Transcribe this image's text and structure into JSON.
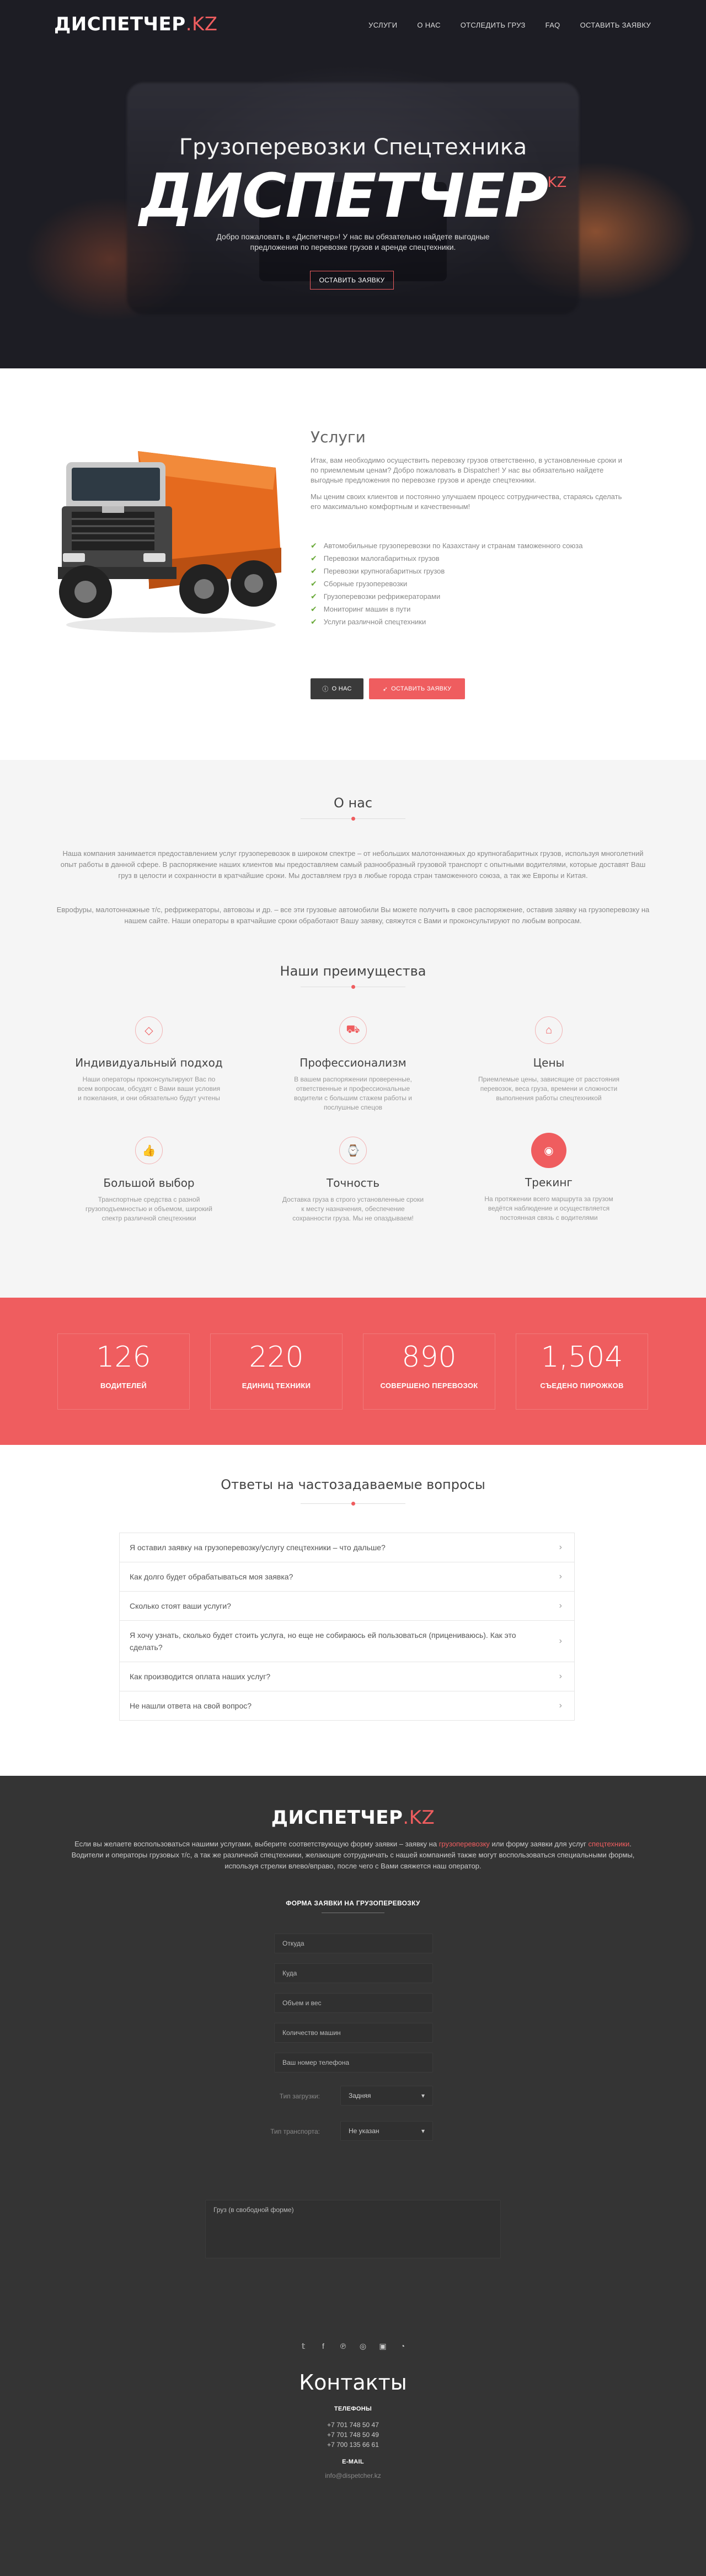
{
  "logo": {
    "main": "ДИСПЕТЧЕР",
    "suffix": ".KZ"
  },
  "nav": [
    "УСЛУГИ",
    "О НАС",
    "ОТСЛЕДИТЬ ГРУЗ",
    "FAQ",
    "ОСТАВИТЬ ЗАЯВКУ"
  ],
  "hero": {
    "subtitle": "Грузоперевозки Спецтехника",
    "title": "ДИСПЕТЧЕР",
    "title_sup": "KZ",
    "intro": "Добро пожаловать в «Диспетчер»! У нас вы обязательно найдете выгодные предложения по перевозке грузов и аренде спецтехники.",
    "cta": "ОСТАВИТЬ ЗАЯВКУ"
  },
  "services": {
    "title": "Услуги",
    "p1": "Итак, вам необходимо осуществить перевозку грузов ответственно, в установленные сроки и по приемлемым ценам? Добро пожаловать в Dispatcher! У нас вы обязательно найдете выгодные предложения по перевозке грузов и аренде спецтехники.",
    "p2": "Мы ценим своих клиентов и постоянно улучшаем процесс сотрудничества, стараясь сделать его максимально комфортным и качественным!",
    "items": [
      "Автомобильные грузоперевозки по Казахстану и странам таможенного союза",
      "Перевозки малогабаритных грузов",
      "Перевозки крупногабаритных грузов",
      "Сборные грузоперевозки",
      "Грузоперевозки рефрижераторами",
      "Мониторинг машин в пути",
      "Услуги различной спецтехники"
    ],
    "btn_about": "О НАС",
    "btn_order": "ОСТАВИТЬ ЗАЯВКУ"
  },
  "about": {
    "title": "О нас",
    "p1": "Наша компания занимается предоставлением услуг грузоперевозок в широком спектре – от небольших малотоннажных до крупногабаритных грузов, используя многолетний опыт работы в данной сфере. В распоряжение наших клиентов мы предоставляем самый разнообразный грузовой транспорт с опытными водителями, которые доставят Ваш груз в целости и сохранности в кратчайшие сроки. Мы доставляем груз в любые города стран таможенного союза, а так же Европы и Китая.",
    "p2": "Еврофуры, малотоннажные т/с, рефрижераторы, автовозы и др. – все эти грузовые автомобили Вы можете получить в свое распоряжение, оставив заявку на грузоперевозку на нашем сайте. Наши операторы в кратчайшие сроки обработают Вашу заявку, свяжутся с Вами и проконсультируют по любым вопросам.",
    "adv_title": "Наши преимущества",
    "features": [
      {
        "icon": "diamond-icon",
        "title": "Индивидуальный подход",
        "text": "Наши операторы проконсультируют Вас по всем вопросам, обсудят с Вами ваши условия и пожелания, и они обязательно будут учтены"
      },
      {
        "icon": "truck-icon",
        "title": "Профессионализм",
        "text": "В вашем распоряжении проверенные, ответственные и профессиональные водители с большим стажем работы и послушные спецов"
      },
      {
        "icon": "tag-icon",
        "title": "Цены",
        "text": "Приемлемые цены, зависящие от расстояния перевозок, веса груза, времени и сложности выполнения работы спецтехникой"
      },
      {
        "icon": "thumbs-up-icon",
        "title": "Большой выбор",
        "text": "Транспортные средства с разной грузоподъемностью и объемом, широкий спектр различной спецтехники"
      },
      {
        "icon": "watch-icon",
        "title": "Точность",
        "text": "Доставка груза в строго установленные сроки к месту назначения, обеспечение сохранности груза. Мы не опаздываем!"
      },
      {
        "icon": "eye-icon",
        "title": "Трекинг",
        "text": "На протяжении всего маршрута за грузом ведётся наблюдение и осуществляется постоянная связь с водителями"
      }
    ]
  },
  "stats": [
    {
      "value": "126",
      "label": "ВОДИТЕЛЕЙ"
    },
    {
      "value": "220",
      "label": "ЕДИНИЦ ТЕХНИКИ"
    },
    {
      "value": "890",
      "label": "СОВЕРШЕНО ПЕРЕВОЗОК"
    },
    {
      "value": "1,504",
      "label": "СЪЕДЕНО ПИРОЖКОВ"
    }
  ],
  "faq": {
    "title": "Ответы на частозадаваемые вопросы",
    "items": [
      "Я оставил заявку на грузоперевозку/услугу спецтехники – что дальше?",
      "Как долго будет обрабатываться моя заявка?",
      "Сколько стоят ваши услуги?",
      "Я хочу узнать, сколько будет стоить услуга, но еще не собираюсь ей пользоваться (прицениваюсь). Как это сделать?",
      "Как производится оплата наших услуг?",
      "Не нашли ответа на свой вопрос?"
    ]
  },
  "footer": {
    "text_a": "Если вы желаете воспользоваться нашими услугами, выберите соответствующую форму заявки – заявку на ",
    "link1": "грузоперевозку",
    "text_b": " или форму заявки для услуг ",
    "link2": "спецтехники",
    "text_c": ". Водители и операторы грузовых т/с, а так же различной спецтехники, желающие сотрудничать с нашей компанией также могут воспользоваться специальными формы, используя стрелки влево/вправо, после чего с Вами свяжется наш оператор.",
    "form_title": "ФОРМА ЗАЯВКИ НА ГРУЗОПЕРЕВОЗКУ",
    "placeholders": [
      "Откуда",
      "Куда",
      "Объем и вес",
      "Количество машин",
      "Ваш номер телефона"
    ],
    "load_label": "Тип загрузки:",
    "load_value": "Задняя",
    "transport_label": "Тип транспорта:",
    "transport_value": "Не указан",
    "cargo_placeholder": "Груз (в свободной форме)",
    "contacts_title": "Контакты",
    "phones_label": "ТЕЛЕФОНЫ",
    "phones": [
      "+7 701 748 50 47",
      "+7 701 748 50 49",
      "+7 700 135 66 61"
    ],
    "email_label": "E-MAIL",
    "email": "info@dispetcher.kz"
  },
  "social_icons": [
    "twitter-icon",
    "facebook-icon",
    "pinterest-icon",
    "dribbble-icon",
    "instagram-icon",
    "rss-icon"
  ],
  "colors": {
    "accent": "#ef5d5f",
    "dark": "#343434",
    "check": "#6aaa3a"
  }
}
